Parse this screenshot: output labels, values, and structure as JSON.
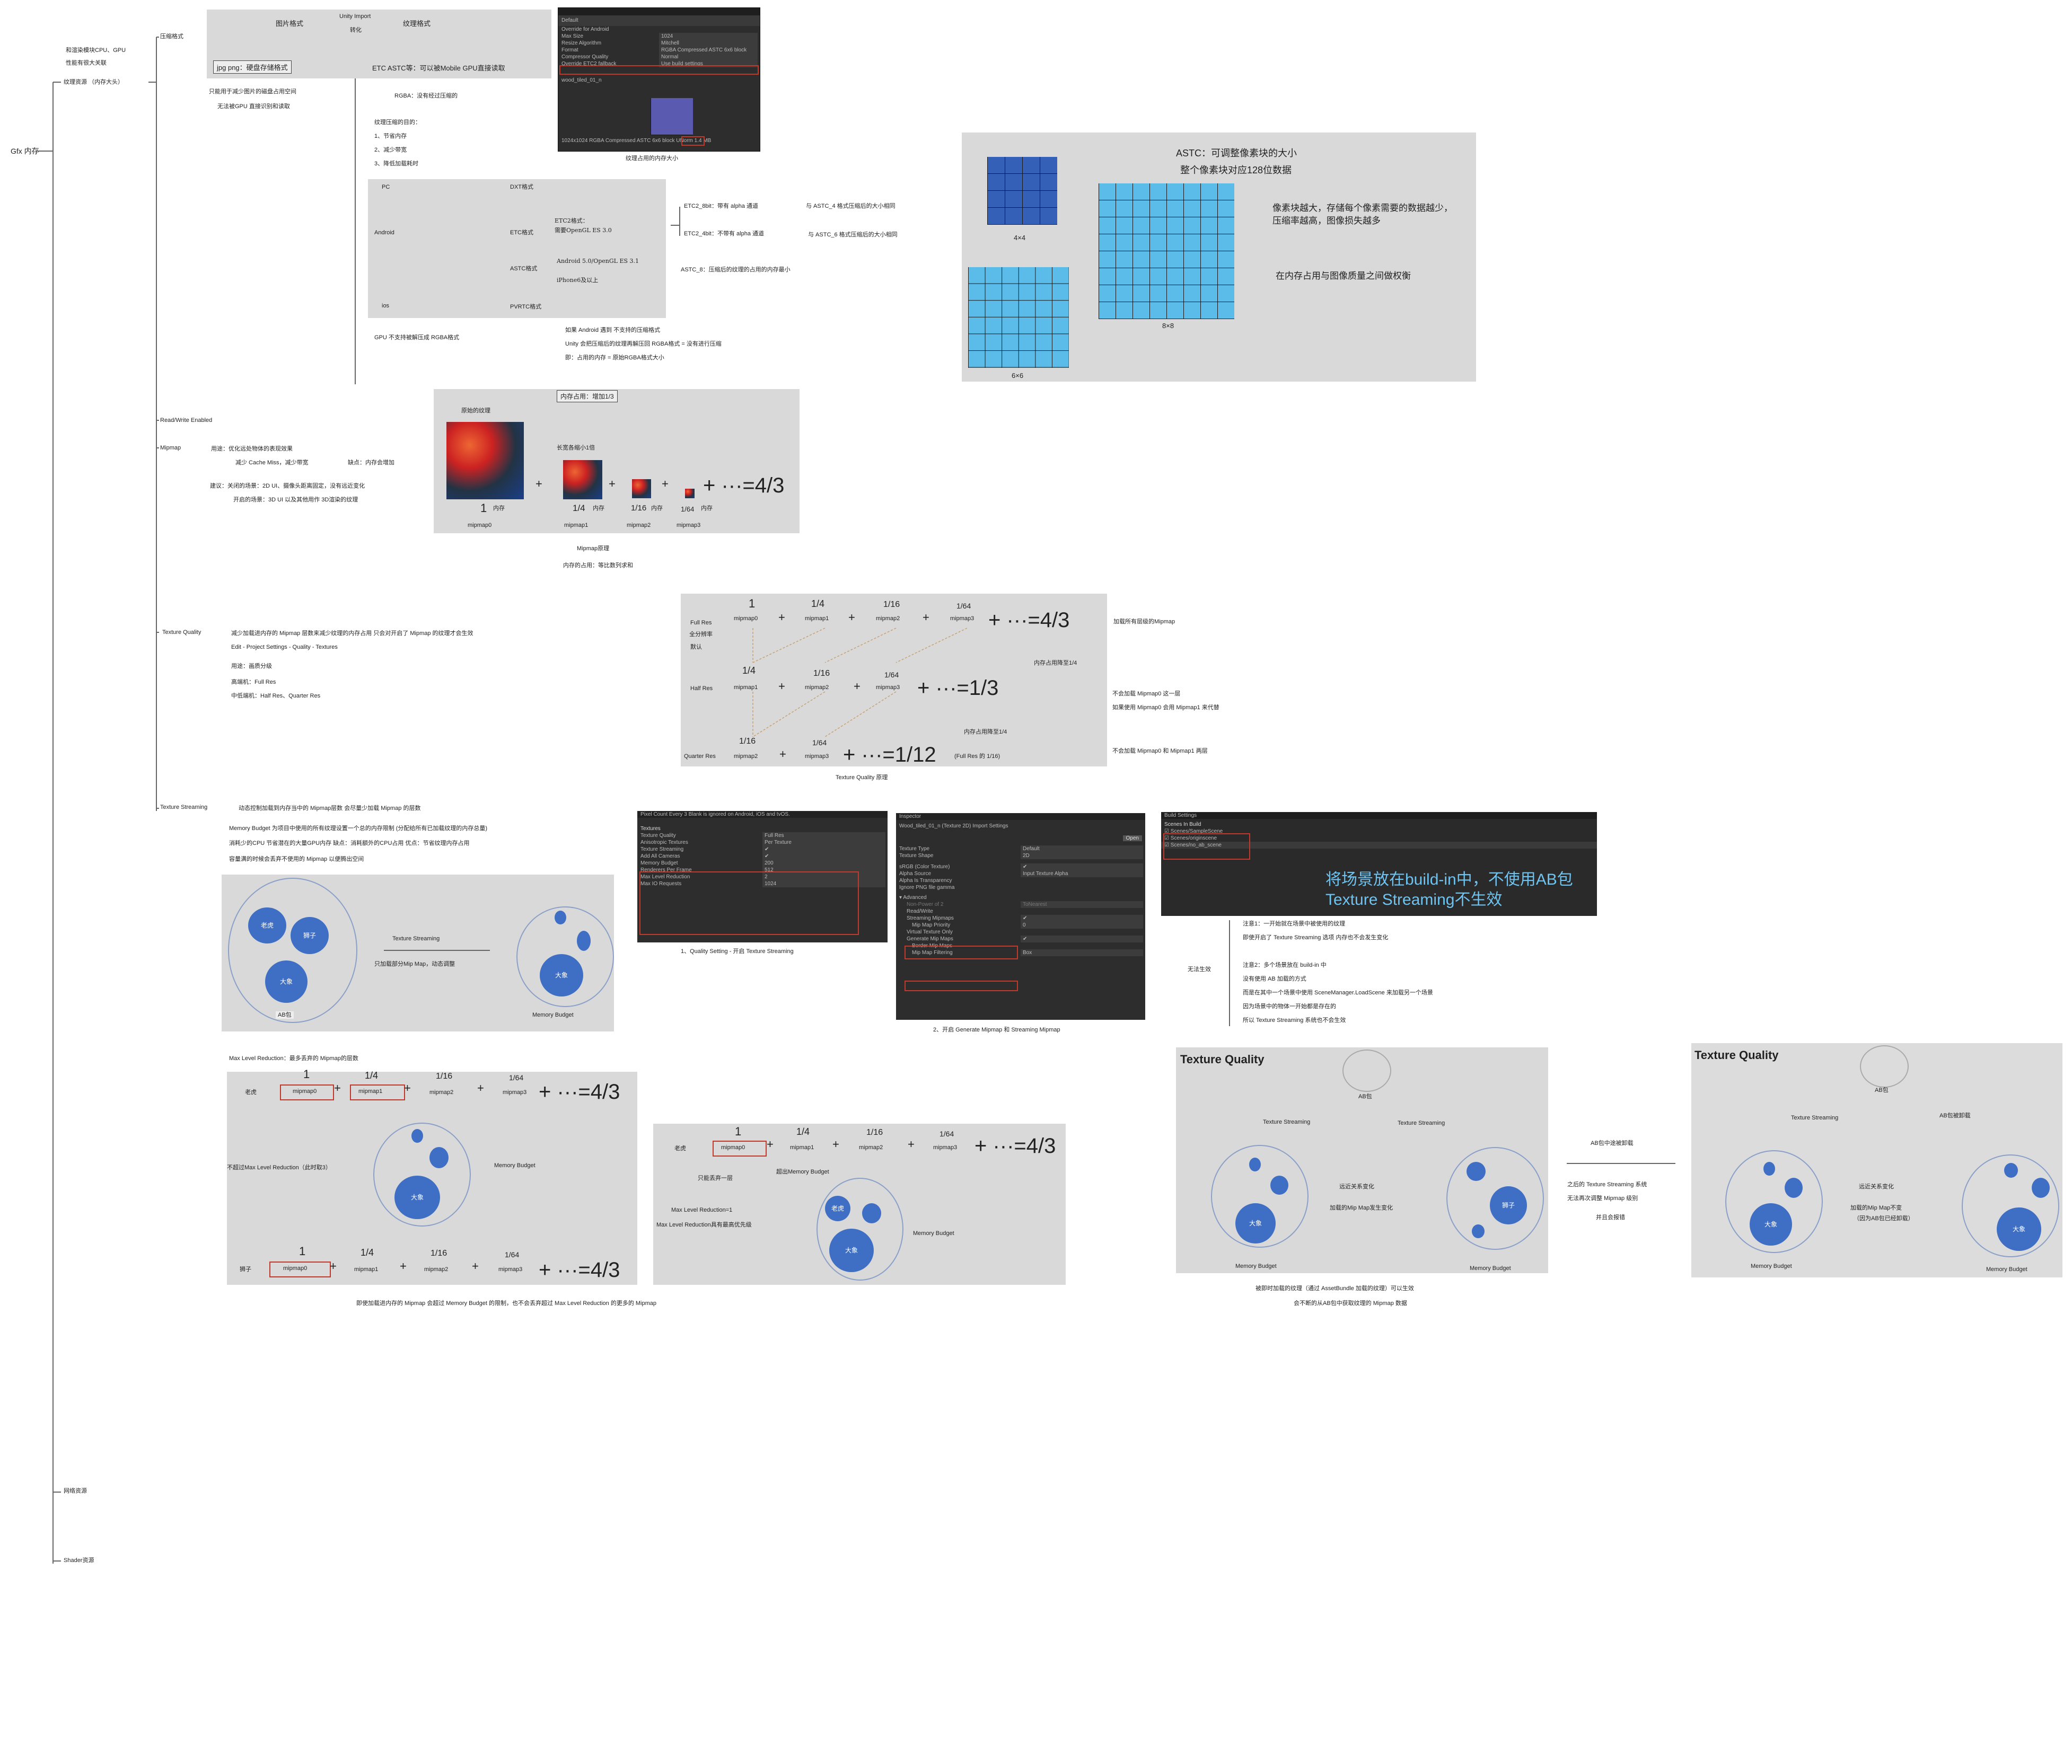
{
  "root": {
    "gfx": "Gfx 内存",
    "texture_res": "纹理资源 （内存大头）",
    "net_res": "网络资源",
    "shader_res": "Shader资源",
    "note_cpu_gpu_1": "和渲染模块CPU、GPU",
    "note_cpu_gpu_2": "性能有很大关联"
  },
  "compress": {
    "label": "压缩格式",
    "img_format": "图片格式",
    "unity_import": "Unity Import",
    "convert": "转化",
    "texture_format": "纹理格式",
    "jpg_png": "jpg png：硬盘存储格式",
    "etc_astc": "ETC ASTC等：可以被Mobile GPU直接读取",
    "only_disk_1": "只能用于减少图片的磁盘占用空间",
    "only_disk_2": "无法被GPU 直接识别和读取",
    "rgba": "RGBA：没有经过压缩的",
    "purpose_title": "纹理压缩的目的：",
    "purpose": [
      "1、节省内存",
      "2、减少带宽",
      "3、降低加载耗时"
    ],
    "platforms": {
      "pc": "PC",
      "android": "Android",
      "ios": "ios"
    },
    "formats": {
      "dxt": "DXT格式",
      "etc": "ETC格式",
      "astc": "ASTC格式",
      "pvrtc": "PVRTC格式"
    },
    "etc2_note_1": "ETC2格式：",
    "etc2_note_2": "需要OpenGL ES 3.0",
    "astc_note_1": "Android 5.0/OpenGL ES 3.1",
    "astc_note_2": "iPhone6及以上",
    "gpu_unsupported": "GPU 不支持被解压成 RGBA格式",
    "etc2_8bit": "ETC2_8bit：带有 alpha 通道",
    "etc2_8bit_cmp": "与 ASTC_4 格式压缩后的大小相同",
    "etc2_4bit": "ETC2_4bit：不带有 alpha 通道",
    "etc2_4bit_cmp": "与 ASTC_6 格式压缩后的大小相同",
    "astc_8": "ASTC_8：压缩后的纹理的占用的内存最小",
    "android_note": [
      "如果 Android 遇到 不支持的压缩格式",
      "Unity 会把压缩后的纹理再解压回 RGBA格式 = 没有进行压缩",
      "即：占用的内存 = 原始RGBA格式大小"
    ],
    "mem_caption": "纹理占用的内存大小",
    "unity_panel": {
      "tab": "Default",
      "rows": [
        [
          "Override for Android",
          ""
        ],
        [
          "Max Size",
          "1024"
        ],
        [
          "Resize Algorithm",
          "Mitchell"
        ],
        [
          "Format",
          "RGBA Compressed ASTC 6x6 block"
        ],
        [
          "Compressor Quality",
          "Normal"
        ],
        [
          "Override ETC2 fallback",
          "Use build settings"
        ]
      ],
      "file": "wood_tiled_01_n",
      "stat": "1024x1024 RGBA Compressed ASTC 6x6 block UNorm  1.4 MB"
    }
  },
  "astc": {
    "title_1": "ASTC：可调整像素块的大小",
    "title_2": "整个像素块对应128位数据",
    "grid_44": "4×4",
    "grid_66": "6×6",
    "grid_88": "8×8",
    "note_1": "像素块越大，存储每个像素需要的数据越少，",
    "note_2": "压缩率越高，图像损失越多",
    "note_3": "在内存占用与图像质量之间做权衡"
  },
  "rw": {
    "label": "Read/Write Enabled"
  },
  "mipmap": {
    "label": "Mipmap",
    "use_1": "用途：优化远处物体的表现效果",
    "use_2": "减少 Cache Miss，减少带宽",
    "cost": "缺点：内存会增加",
    "advice_1": "建议：关闭的场景：2D UI、摄像头距离固定，没有远近变化",
    "advice_2": "开启的场景：3D UI 以及其他用作 3D渲染的纹理",
    "mem_add": "内存占用：增加1/3",
    "orig": "原始的纹理",
    "halved": "长宽各缩小1倍",
    "one": "1",
    "mem": "内存",
    "quarter": "1/4",
    "sixteenth": "1/16",
    "sixtyfourth": "1/64",
    "sum": "+ ···=4/3",
    "names": [
      "mipmap0",
      "mipmap1",
      "mipmap2",
      "mipmap3"
    ],
    "caption_1": "Mipmap原理",
    "caption_2": "内存的占用：等比数列求和"
  },
  "tq": {
    "label": "Texture Quality",
    "desc_1": "减少加载进内存的 Mipmap 层数来减少纹理的内存占用  只会对开启了 Mipmap 的纹理才会生效",
    "desc_2": "Edit - Project Settings - Quality - Textures",
    "use": "用途：画质分级",
    "high": "高端机：Full Res",
    "mid": "中低端机：Half Res、Quarter Res",
    "full": "Full Res",
    "full_sub_1": "全分辨率",
    "full_sub_2": "默认",
    "half": "Half Res",
    "quarter": "Quarter Res",
    "sum_full": "+ ···=4/3",
    "sum_half": "+ ···=1/3",
    "sum_quarter": "+ ···=1/12",
    "quarter_note": "(Full Res 的 1/16)",
    "drop_1": "内存占用降至1/4",
    "drop_2": "内存占用降至1/4",
    "r_full": "加载所有层级的Mipmap",
    "r_half_1": "不会加载 Mipmap0 这一层",
    "r_half_2": "如果使用 Mipmap0 会用 Mipmap1 来代替",
    "r_quarter": "不会加载 Mipmap0 和 Mipmap1 两层",
    "caption": "Texture Quality 原理"
  },
  "ts": {
    "label": "Texture Streaming",
    "desc_1": "动态控制加载到内存当中的 Mipmap层数  会尽量少加载 Mipmap 的层数",
    "desc_2": "Memory Budget 为项目中使用的所有纹理设置一个总的内存限制 (分配给所有已加载纹理的内存总量)",
    "desc_3": "消耗少的CPU 节省潜在的大量GPU内存        缺点：消耗额外的CPU占用       优点：节省纹理内存占用",
    "desc_4": "容量满的时候会丢弃不使用的 Mipmap 以便腾出空间",
    "tiger": "老虎",
    "lion": "狮子",
    "elephant": "大象",
    "ab": "AB包",
    "budget": "Memory Budget",
    "arrow_1": "Texture Streaming",
    "arrow_2": "只加载部分Mip Map，动态调整",
    "quality_caption": "1、Quality Setting - 开启 Texture Streaming",
    "import_caption": "2、开启 Generate Mipmap 和 Streaming Mipmap",
    "quality_panel": {
      "banner": "Pixel Count Every 3 Blank is ignored on Android, iOS and tvOS.",
      "section": "Textures",
      "rows": [
        [
          "Texture Quality",
          "Full Res"
        ],
        [
          "Anisotropic Textures",
          "Per Texture"
        ],
        [
          "Texture Streaming",
          "✔"
        ],
        [
          "Add All Cameras",
          "✔"
        ],
        [
          "Memory Budget",
          "200"
        ],
        [
          "Renderers Per Frame",
          "512"
        ],
        [
          "Max Level Reduction",
          "2"
        ],
        [
          "Max IO Requests",
          "1024"
        ]
      ]
    },
    "import_panel": {
      "tab": "Inspector",
      "title": "Wood_tiled_01_n (Texture 2D) Import Settings",
      "open": "Open",
      "rows": [
        [
          "Texture Type",
          "Default"
        ],
        [
          "Texture Shape",
          "2D"
        ],
        [
          "sRGB (Color Texture)",
          "✔"
        ],
        [
          "Alpha Source",
          "Input Texture Alpha"
        ],
        [
          "Alpha Is Transparency",
          ""
        ],
        [
          "Ignore PNG file gamma",
          ""
        ],
        [
          "▾ Advanced",
          ""
        ],
        [
          "Non-Power of 2",
          "ToNearest"
        ],
        [
          "Read/Write",
          ""
        ],
        [
          "Streaming Mipmaps",
          "✔"
        ],
        [
          "Mip Map Priority",
          "0"
        ],
        [
          "Virtual Texture Only",
          ""
        ],
        [
          "Generate Mip Maps",
          "✔"
        ],
        [
          "Border Mip Maps",
          ""
        ],
        [
          "Mip Map Filtering",
          "Box"
        ]
      ]
    },
    "build_panel": {
      "tab": "Build Settings",
      "section": "Scenes In Build",
      "scenes": [
        "Scenes/SampleScene",
        "Scenes/originscene",
        "Scenes/no_ab_scene"
      ],
      "big_1": "将场景放在build-in中，不使用AB包",
      "big_2": "Texture Streaming不生效"
    },
    "invalid": "无法生效",
    "n1_1": "注意1：一开始就在场景中被使用的纹理",
    "n1_2": "即使开启了 Texture Streaming 选项 内存也不会发生变化",
    "n2_1": "注意2：多个场景放在 build-in 中",
    "n2_2": "没有使用 AB 加载的方式",
    "n2_3": "而是在其中一个场景中使用 SceneManager.LoadScene 来加载另一个场景",
    "n2_4": "因为场景中的物体一开始都是存在的",
    "n2_5": "所以 Texture Streaming 系统也不会生效",
    "mlr_title": "Max Level Reduction：最多丢弃的 Mipmap的层数",
    "mlr_note": "不超过Max Level Reduction（此时取3）",
    "mlr_caption": "即使加载进内存的 Mipmap 会超过 Memory Budget 的限制，也不会丢弃超过 Max Level Reduction 的更多的 Mipmap",
    "only_drop": "只能丢弃一层",
    "exceed": "超出Memory Budget",
    "mlr_1": "Max Level Reduction=1",
    "mlr_pri": "Max Level Reduction具有最高优先级",
    "tq_title": "Texture Quality",
    "streaming": "Texture Streaming",
    "near_far": "远近关系变化",
    "mip_change": "加载的Mip Map发生变化",
    "ab_unloaded": "AB包中途被卸载",
    "after_1": "之后的 Texture Streaming 系统",
    "after_2": "无法再次调整 Mipmap 级别",
    "after_3": "并且会报错",
    "ab_was_unloaded": "AB包被卸载",
    "mip_same_1": "加载的Mip Map不变",
    "mip_same_2": "（因为AB包已经卸载）",
    "bottom_1": "被即时加载的纹理（通过 AssetBundle 加载的纹理）可以生效",
    "bottom_2": "会不断的从AB包中获取纹理的 Mipmap 数据"
  }
}
